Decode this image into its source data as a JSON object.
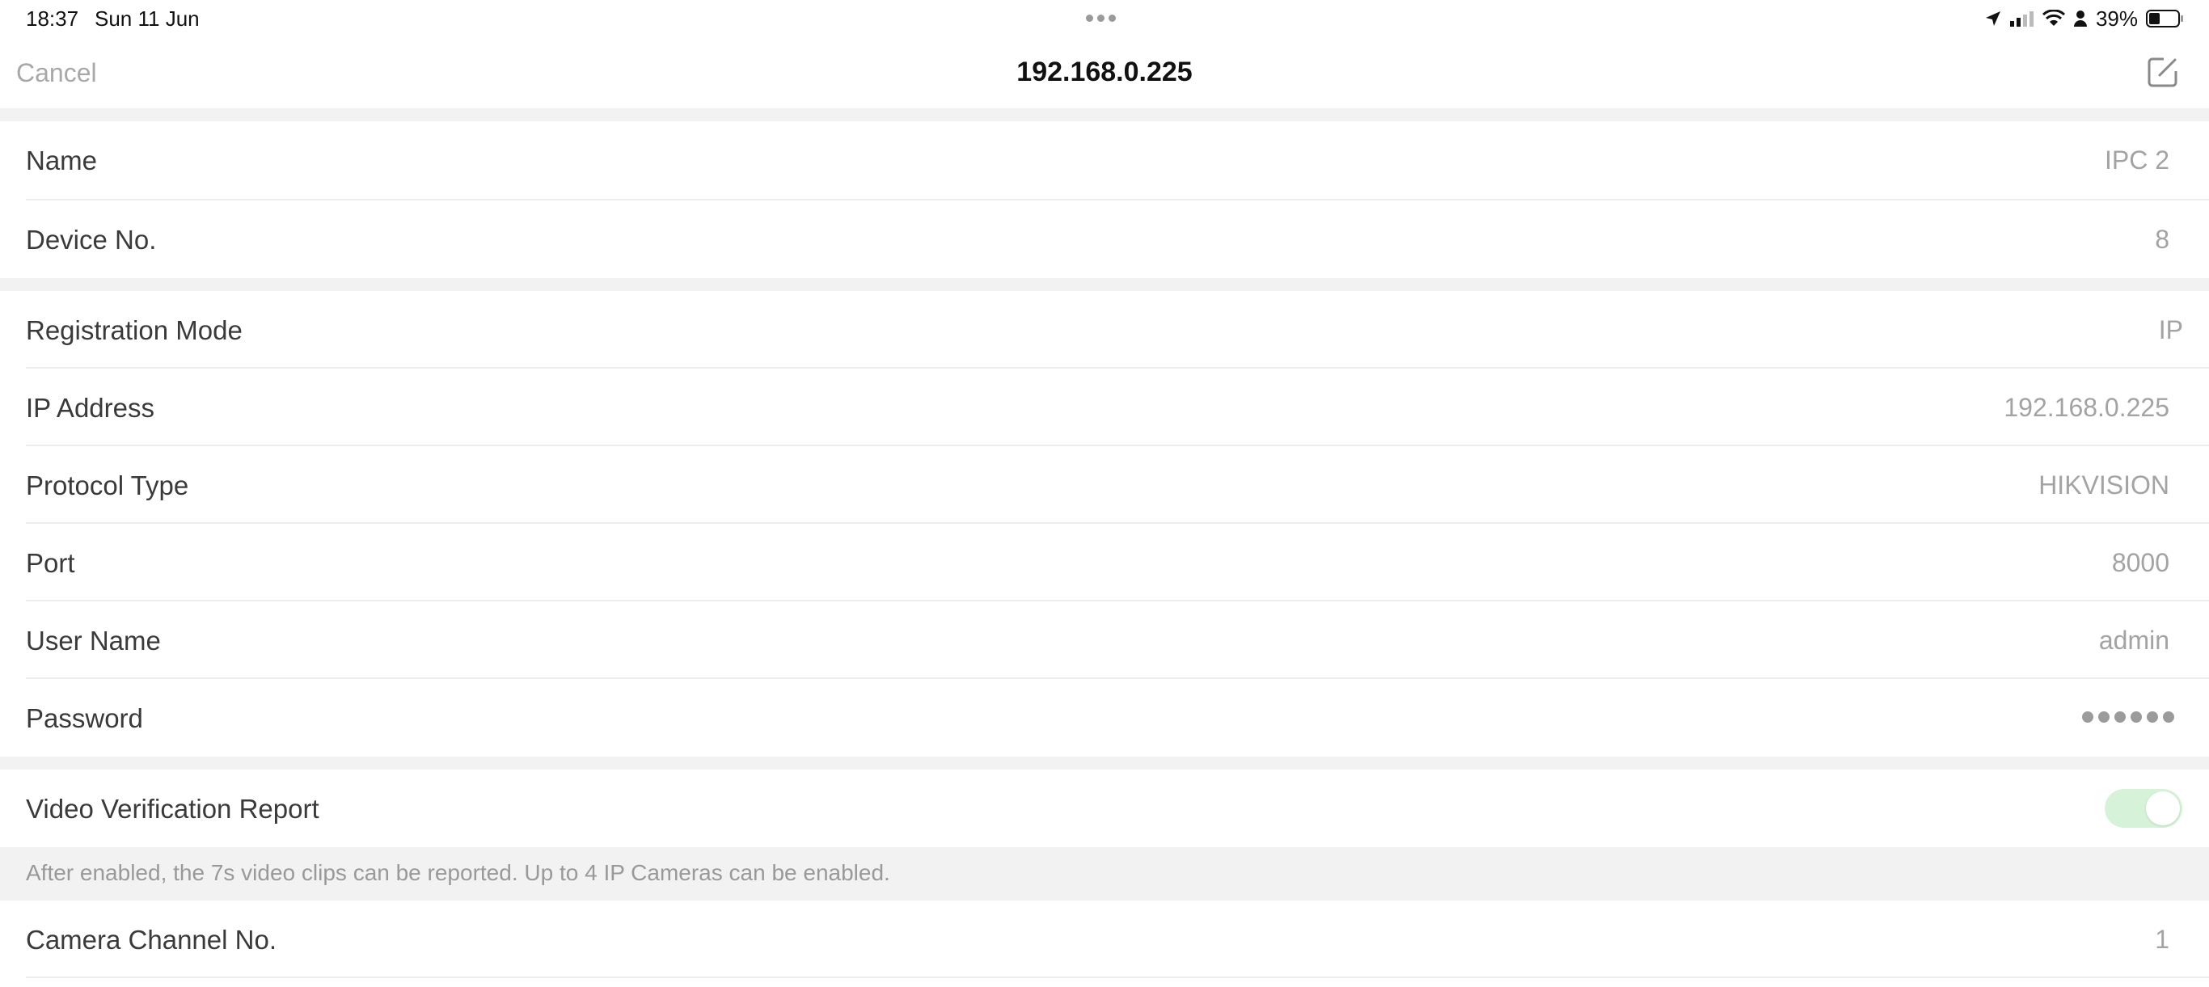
{
  "status_bar": {
    "time": "18:37",
    "date": "Sun 11 Jun",
    "battery_percent": "39%",
    "icons": [
      "location-arrow-icon",
      "cellular-signal-icon",
      "wifi-icon",
      "person-icon",
      "battery-icon"
    ],
    "battery_level": 0.39
  },
  "nav": {
    "cancel_label": "Cancel",
    "title": "192.168.0.225",
    "edit_icon": "edit-icon"
  },
  "section1": {
    "name": {
      "label": "Name",
      "value": "IPC 2"
    },
    "device_no": {
      "label": "Device No.",
      "value": "8"
    }
  },
  "section2": {
    "registration_mode": {
      "label": "Registration Mode",
      "value": "IP"
    },
    "ip_address": {
      "label": "IP Address",
      "value": "192.168.0.225"
    },
    "protocol_type": {
      "label": "Protocol Type",
      "value": "HIKVISION"
    },
    "port": {
      "label": "Port",
      "value": "8000"
    },
    "user_name": {
      "label": "User Name",
      "value": "admin"
    },
    "password": {
      "label": "Password",
      "masked_length": 6
    }
  },
  "section3": {
    "video_verification": {
      "label": "Video Verification Report",
      "enabled": true
    },
    "note": "After enabled, the 7s video clips can be reported. Up to 4 IP Cameras can be enabled.",
    "camera_channel": {
      "label": "Camera Channel No.",
      "value": "1"
    }
  },
  "colors": {
    "background": "#ffffff",
    "group_separator": "#f2f2f2",
    "label_text": "#3a3a3a",
    "value_text": "#a3a3a3",
    "toggle_on": "#d6f3da"
  }
}
